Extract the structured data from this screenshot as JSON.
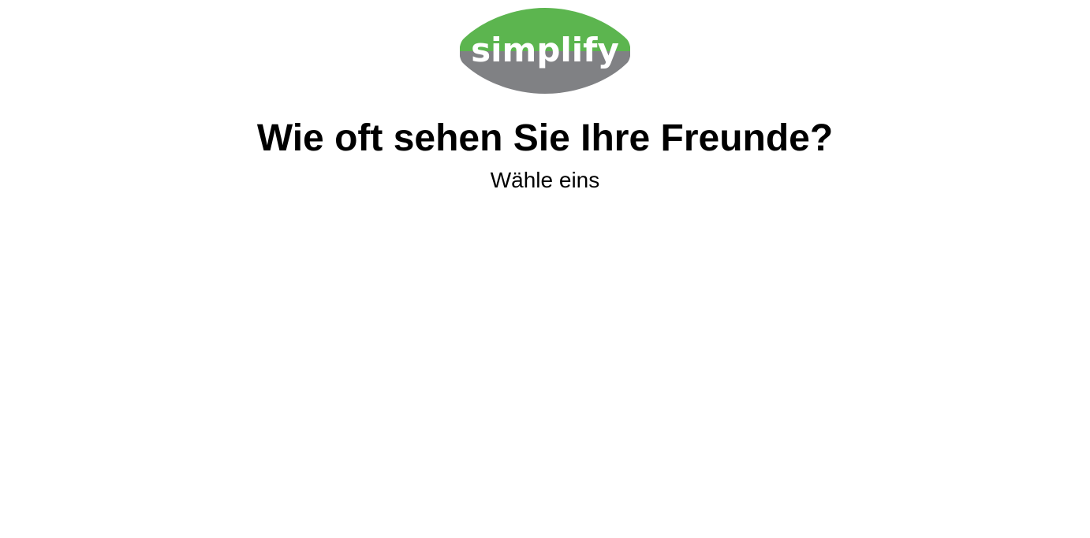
{
  "logo": {
    "text": "simplify",
    "icon": "simplify-logo",
    "colors": {
      "top": "#5cb54f",
      "bottom": "#808184",
      "text": "#ffffff"
    }
  },
  "survey": {
    "question": "Wie oft sehen Sie Ihre Freunde?",
    "instruction": "Wähle eins"
  }
}
